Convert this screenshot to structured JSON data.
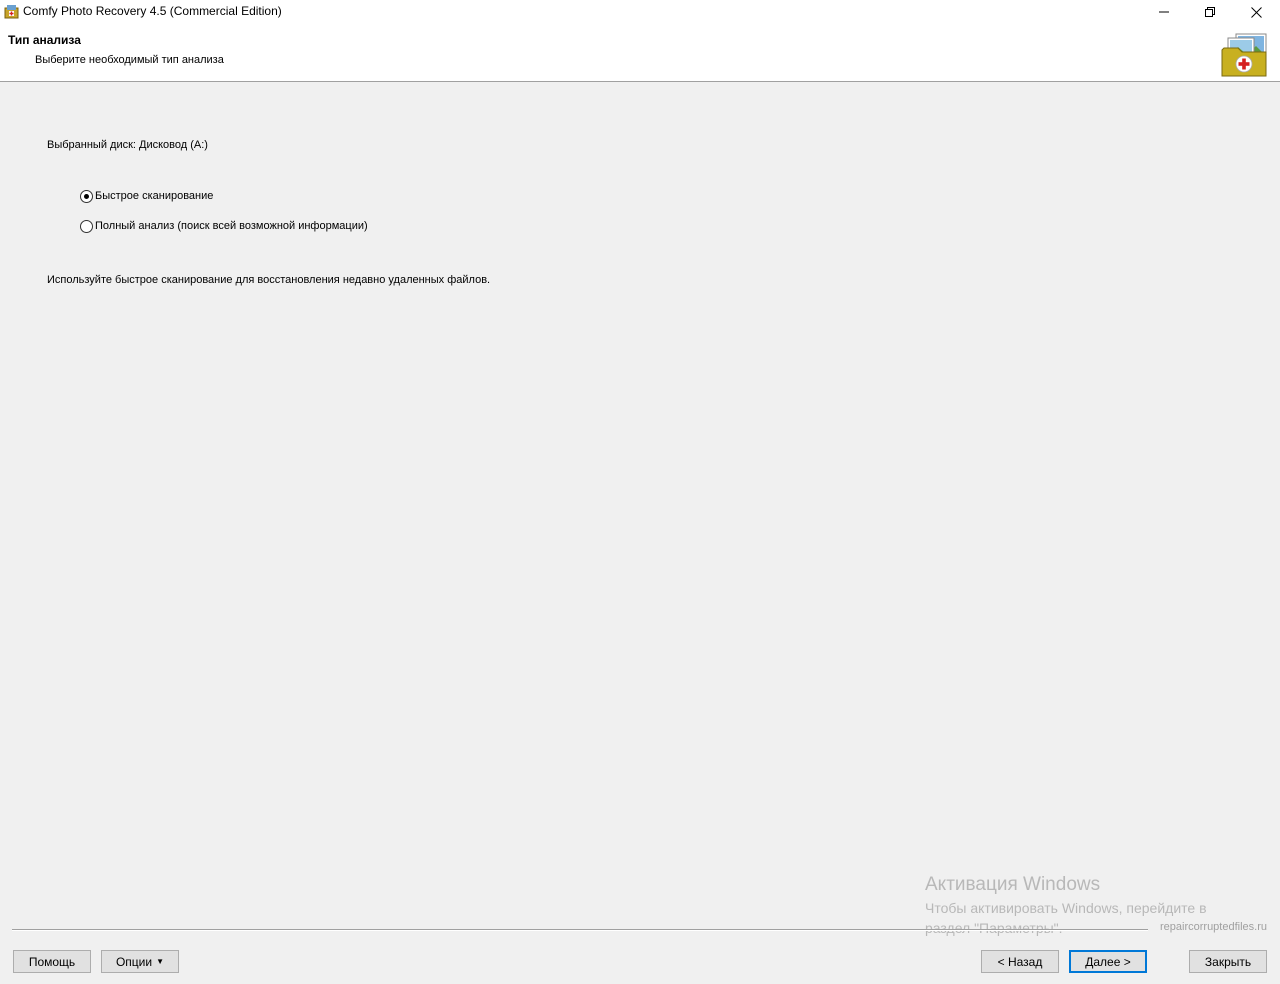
{
  "window": {
    "title": "Comfy Photo Recovery 4.5 (Commercial Edition)"
  },
  "header": {
    "title": "Тип анализа",
    "subtitle": "Выберите необходимый тип анализа"
  },
  "content": {
    "selected_disk": "Выбранный диск: Дисковод (A:)",
    "options": [
      {
        "label": "Быстрое сканирование",
        "checked": true
      },
      {
        "label": "Полный анализ (поиск всей возможной информации)",
        "checked": false
      }
    ],
    "hint": "Используйте быстрое сканирование для восстановления недавно удаленных файлов."
  },
  "watermark": {
    "title": "Активация Windows",
    "text": "Чтобы активировать Windows, перейдите в раздел \"Параметры\".",
    "site": "repaircorruptedfiles.ru"
  },
  "footer": {
    "help": "Помощь",
    "options": "Опции",
    "back": "< Назад",
    "next": "Далее >",
    "close": "Закрыть"
  },
  "colors": {
    "accent": "#0078d7",
    "background": "#f0f0f0",
    "logo_folder": "#c8b020",
    "logo_cross": "#d42020"
  }
}
